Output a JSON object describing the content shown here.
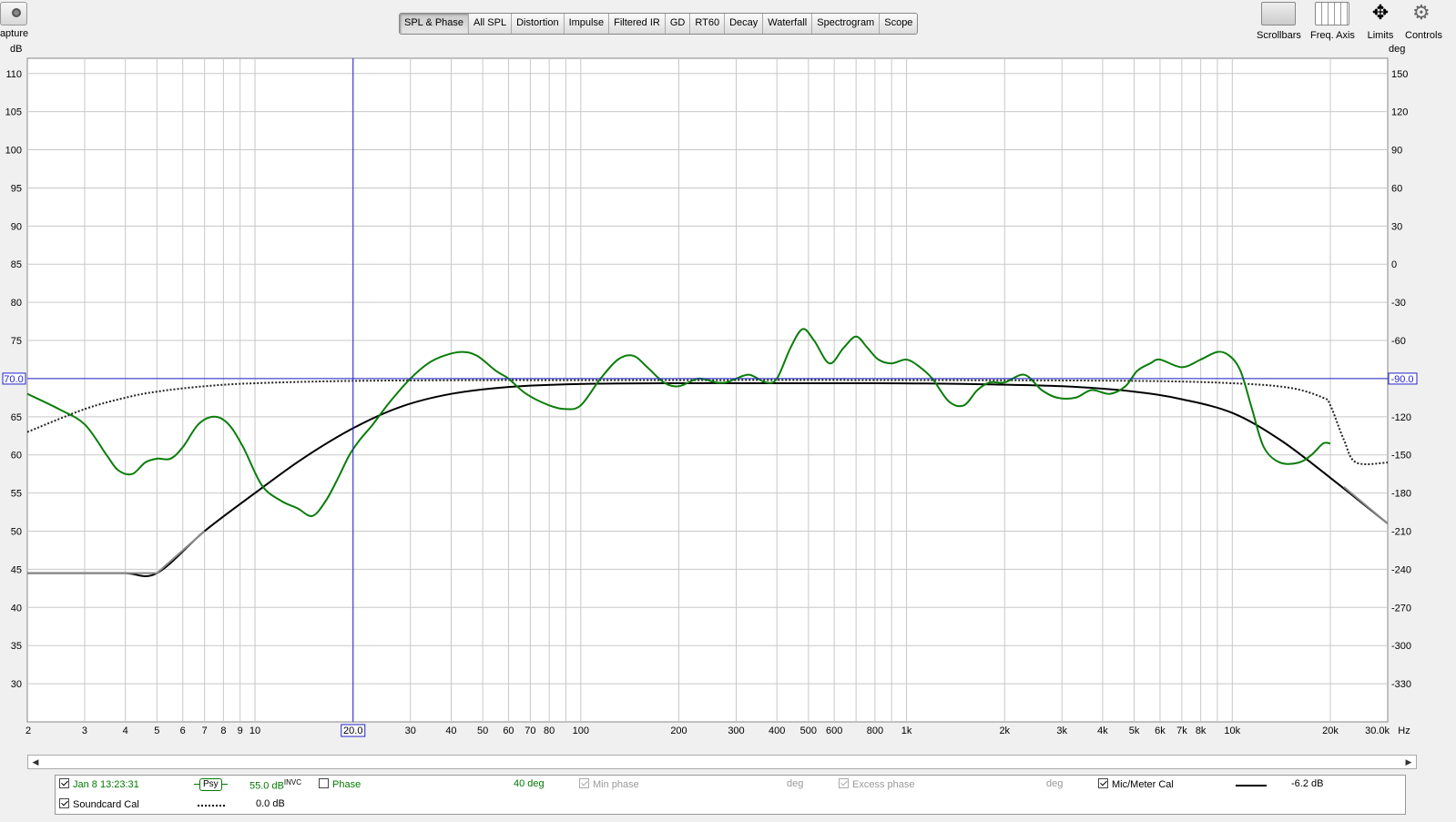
{
  "toolbar": {
    "capture_label": "Capture",
    "tabs": [
      "SPL & Phase",
      "All SPL",
      "Distortion",
      "Impulse",
      "Filtered IR",
      "GD",
      "RT60",
      "Decay",
      "Waterfall",
      "Spectrogram",
      "Scope"
    ],
    "active_tab": "SPL & Phase",
    "right_tools": [
      "Scrollbars",
      "Freq. Axis",
      "Limits",
      "Controls"
    ]
  },
  "graph": {
    "left_unit": "dB",
    "right_unit": "deg",
    "x_unit": "Hz",
    "y_ticks_left": [
      "110",
      "105",
      "100",
      "95",
      "90",
      "85",
      "80",
      "75",
      "70",
      "65",
      "60",
      "55",
      "50",
      "45",
      "40",
      "35",
      "30"
    ],
    "y_ticks_right": [
      "150",
      "120",
      "90",
      "60",
      "30",
      "0",
      "-30",
      "-60",
      "-90",
      "-120",
      "-150",
      "-180",
      "-210",
      "-240",
      "-270",
      "-300",
      "-330"
    ],
    "x_ticks": [
      "2",
      "3",
      "4",
      "5",
      "6",
      "7",
      "8",
      "9",
      "10",
      "20.0",
      "30",
      "40",
      "50",
      "60",
      "70",
      "80",
      "100",
      "200",
      "300",
      "400",
      "500",
      "600",
      "800",
      "1k",
      "2k",
      "3k",
      "4k",
      "5k",
      "6k",
      "7k",
      "8k",
      "10k",
      "20k",
      "30.0k"
    ],
    "cursor_h_label": "70.0",
    "cursor_h_right_label": "-90.0",
    "cursor_v_label": "20.0"
  },
  "chart_data": {
    "type": "line",
    "x_scale": "log",
    "xlim": [
      2,
      30000
    ],
    "ylim": [
      25,
      112
    ],
    "xlabel": "Hz",
    "ylabel": "dB",
    "y2label": "deg",
    "y2lim": [
      -360,
      165
    ],
    "grid": true,
    "cursor": {
      "x": 20.0,
      "y": 70.0
    },
    "series": [
      {
        "name": "Jan 8 13:23:31",
        "color": "#0a7d0a",
        "x": [
          2,
          2.5,
          3,
          3.5,
          3.8,
          4.2,
          4.6,
          5,
          5.5,
          6,
          6.7,
          7.5,
          8.3,
          9.2,
          10.5,
          12,
          13.5,
          15,
          16.5,
          18,
          19.5,
          21,
          23,
          26,
          30,
          34,
          38,
          43,
          48,
          55,
          60,
          68,
          80,
          90,
          100,
          115,
          130,
          145,
          160,
          180,
          200,
          230,
          260,
          280,
          300,
          330,
          370,
          400,
          440,
          480,
          520,
          580,
          640,
          700,
          760,
          820,
          900,
          1000,
          1100,
          1200,
          1350,
          1500,
          1650,
          1800,
          2000,
          2300,
          2600,
          2900,
          3300,
          3700,
          4200,
          4700,
          5100,
          5600,
          6000,
          7000,
          8000,
          9000,
          9800,
          10600,
          11500,
          12500,
          14000,
          16000,
          17500,
          19000,
          20000
        ],
        "y": [
          68,
          66,
          64,
          60,
          58,
          57.5,
          59,
          59.5,
          59.5,
          61,
          64,
          65,
          64,
          61,
          56,
          54,
          53,
          52,
          54,
          57,
          60,
          62,
          64,
          67,
          70,
          72,
          73,
          73.5,
          73,
          71,
          70,
          68,
          66.5,
          66,
          66.5,
          70,
          72.5,
          73,
          71.5,
          69.5,
          69,
          70,
          69.5,
          69.5,
          70,
          70.5,
          69.5,
          70,
          74,
          76.5,
          75,
          72,
          74,
          75.5,
          74,
          72.5,
          72,
          72.5,
          71.5,
          70,
          67,
          66.5,
          68.5,
          69.5,
          69.5,
          70.5,
          68.5,
          67.5,
          67.5,
          68.5,
          68,
          69,
          71,
          72,
          72.5,
          71.5,
          72.5,
          73.5,
          73,
          71,
          66,
          61,
          59,
          59,
          60,
          61.5,
          61.5
        ]
      },
      {
        "name": "Mic/Meter Cal",
        "color": "#000000",
        "x": [
          2,
          3,
          4,
          5,
          7,
          10,
          14,
          20,
          28,
          40,
          60,
          100,
          200,
          400,
          800,
          1500,
          3000,
          5000,
          7000,
          10000,
          14000,
          20000,
          30000
        ],
        "y": [
          44.5,
          44.5,
          44.5,
          44.5,
          50,
          55,
          59.5,
          63.5,
          66.3,
          68,
          68.9,
          69.3,
          69.4,
          69.4,
          69.4,
          69.3,
          69.0,
          68.3,
          67.3,
          65.5,
          62,
          57,
          51
        ]
      },
      {
        "name": "Soundcard Cal",
        "color": "#000000",
        "style": "dotted",
        "x": [
          2,
          3,
          4,
          5,
          7,
          10,
          20,
          50,
          100,
          1000,
          5000,
          10000,
          15000,
          19000,
          20000,
          22000,
          24000,
          30000
        ],
        "y": [
          63,
          66,
          67.5,
          68.3,
          69,
          69.4,
          69.7,
          69.8,
          69.8,
          69.8,
          69.7,
          69.4,
          68.8,
          67.5,
          66.5,
          62,
          59,
          59
        ]
      }
    ]
  },
  "legend": {
    "rows": [
      {
        "checked": true,
        "name": "Jan 8 13:23:31",
        "badge": "Psy",
        "level": "55.0 dB",
        "level_sup": "INVC",
        "phase_label": "Phase",
        "phase_checked": false,
        "phase_value": "40 deg",
        "min_phase_label": "Min phase",
        "min_phase_unit": "deg",
        "excess_phase_label": "Excess phase",
        "excess_phase_unit": "deg",
        "mic_cal_checked": true,
        "mic_cal_label": "Mic/Meter Cal",
        "mic_cal_value": "-6.2 dB"
      },
      {
        "checked": true,
        "name": "Soundcard Cal",
        "value": "0.0 dB"
      }
    ]
  }
}
